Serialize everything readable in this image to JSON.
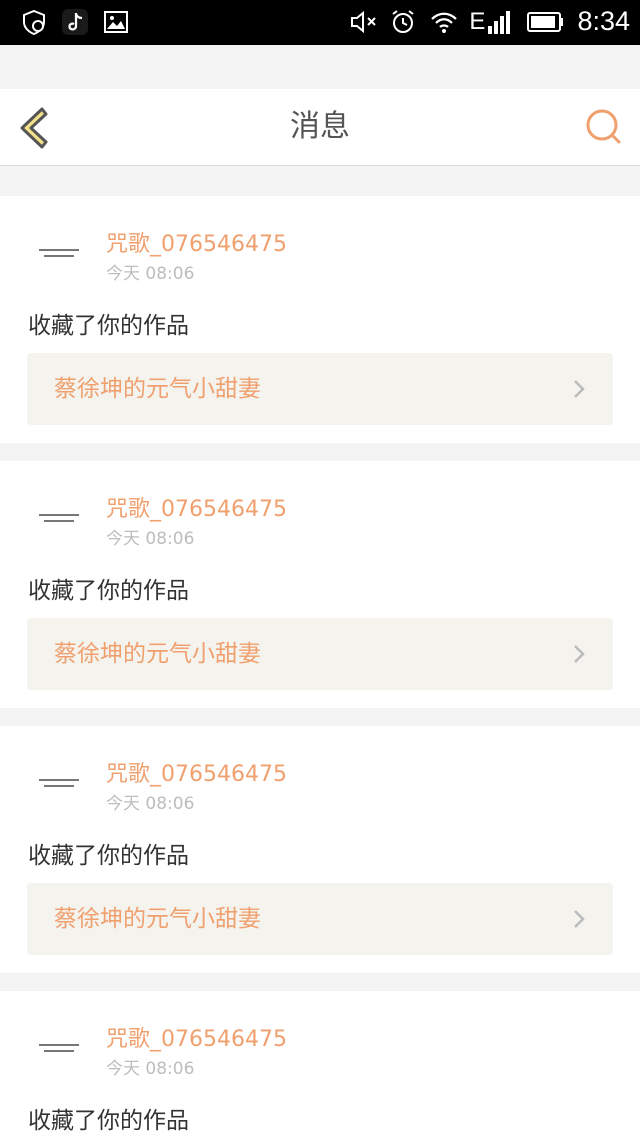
{
  "status_bar": {
    "time": "8:34",
    "network_label": "E"
  },
  "header": {
    "title": "消息"
  },
  "messages": [
    {
      "username": "咒歌_076546475",
      "time": "今天 08:06",
      "action": "收藏了你的作品",
      "work_title": "蔡徐坤的元气小甜妻"
    },
    {
      "username": "咒歌_076546475",
      "time": "今天 08:06",
      "action": "收藏了你的作品",
      "work_title": "蔡徐坤的元气小甜妻"
    },
    {
      "username": "咒歌_076546475",
      "time": "今天 08:06",
      "action": "收藏了你的作品",
      "work_title": "蔡徐坤的元气小甜妻"
    },
    {
      "username": "咒歌_076546475",
      "time": "今天 08:06",
      "action": "收藏了你的作品",
      "work_title": ""
    }
  ],
  "colors": {
    "accent": "#f0a06e",
    "back_icon_fill": "#f5e08a",
    "back_icon_stroke": "#555555"
  }
}
